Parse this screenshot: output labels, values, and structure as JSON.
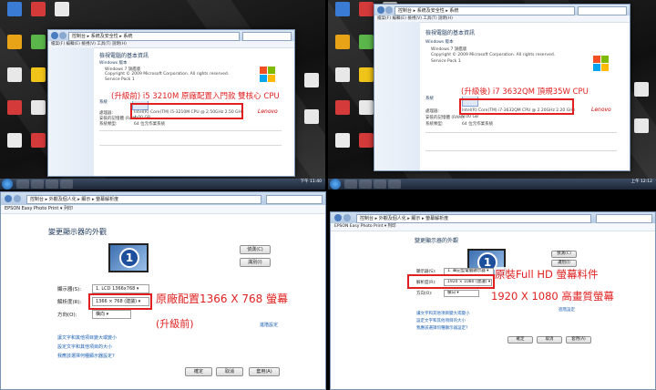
{
  "colors": {
    "annotation": "#e02020",
    "link": "#1a5fb4",
    "accent": "#1e4f9c"
  },
  "top_left": {
    "annotation": "(升級前) i5 3210M 原廠配置入門款 雙核心 CPU",
    "address": "控制台 ▸ 系統及安全性 ▸ 系統",
    "menu": "檔案(F)  編輯(E)  檢視(V)  工具(T)  說明(H)",
    "heading": "檢視電腦的基本資訊",
    "edition_header": "Windows 版本",
    "edition": "Windows 7 旗艦版",
    "copyright": "Copyright © 2009 Microsoft Corporation. All rights reserved.",
    "service_pack": "Service Pack 1",
    "system_header": "系統",
    "proc_label": "處理器:",
    "proc_value": "Intel(R) Core(TM) i5-3210M CPU @ 2.50GHz 2.50 GHz",
    "ram_label": "安裝的記憶體 (RAM):",
    "ram_value": "4.00 GB",
    "type_label": "系統類型:",
    "type_value": "64 位元作業系統",
    "brand": "Lenovo",
    "taskbar_time": "下午 11:40"
  },
  "top_right": {
    "annotation": "(升級後) i7 3632QM 頂規35W  CPU",
    "address": "控制台 ▸ 系統及安全性 ▸ 系統",
    "menu": "檔案(F)  編輯(E)  檢視(V)  工具(T)  說明(H)",
    "heading": "檢視電腦的基本資訊",
    "edition_header": "Windows 版本",
    "edition": "Windows 7 旗艦版",
    "copyright": "Copyright © 2009 Microsoft Corporation. All rights reserved.",
    "service_pack": "Service Pack 1",
    "system_header": "系統",
    "proc_label": "處理器:",
    "proc_value": "Intel(R) Core(TM) i7-3632QM CPU @ 2.20GHz 2.20 GHz",
    "ram_label": "安裝的記憶體 (RAM):",
    "ram_value": "8.00 GB",
    "type_label": "系統類型:",
    "type_value": "64 位元作業系統",
    "brand": "Lenovo",
    "taskbar_time": "上午 12:12"
  },
  "bottom_left": {
    "address": "控制台 ▸ 外觀及個人化 ▸ 顯示 ▸ 螢幕解析度",
    "menu_app": "EPSON Easy Photo Print ▾  列印",
    "heading": "變更顯示器的外觀",
    "detect_button": "偵測(C)",
    "identify_button": "識別(I)",
    "display_label": "顯示器(S):",
    "display_value": "1. LCD 1366x768 ▾",
    "resolution_label": "解析度(R):",
    "resolution_value": "1366 × 768 (建議) ▾",
    "orientation_label": "方向(O):",
    "orientation_value": "橫向 ▾",
    "advanced_link": "進階設定",
    "annotation_main": "原廠配置1366 X 768 螢幕",
    "annotation_sub": "(升級前)",
    "link1": "讓文字和其他項目變大或變小",
    "link2": "設定文字和其他項目的大小",
    "link3": "我應該選擇何種顯示器設定?",
    "ok_button": "確定",
    "cancel_button": "取消",
    "apply_button": "套用(A)"
  },
  "bottom_right": {
    "address": "控制台 ▸ 外觀及個人化 ▸ 顯示 ▸ 螢幕解析度",
    "menu_app": "EPSON Easy Photo Print ▾  列印",
    "heading": "變更顯示器的外觀",
    "detect_button": "偵測(C)",
    "identify_button": "識別(I)",
    "display_label": "顯示器(S):",
    "display_value": "1. 筆記型電腦顯示器 ▾",
    "resolution_label": "解析度(R):",
    "resolution_value": "1920 × 1080 (建議) ▾",
    "orientation_label": "方向(O):",
    "orientation_value": "橫向 ▾",
    "advanced_link": "進階設定",
    "annotation_main": "原裝Full HD 螢幕料件",
    "annotation_sub": "1920 X 1080 高畫質螢幕",
    "link1": "讓文字和其他項目變大或變小",
    "link2": "設定文字和其他項目的大小",
    "link3": "我應該選擇何種顯示器設定?",
    "ok_button": "確定",
    "cancel_button": "取消",
    "apply_button": "套用(A)"
  }
}
